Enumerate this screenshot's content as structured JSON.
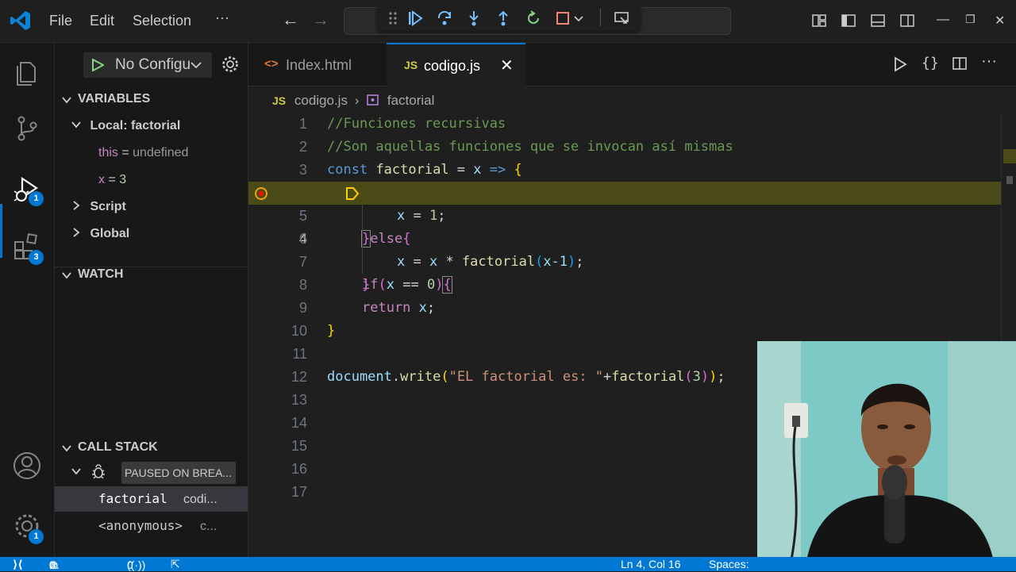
{
  "menu": {
    "file": "File",
    "edit": "Edit",
    "selection": "Selection",
    "more": "···"
  },
  "window": {
    "minimize": "—",
    "restore": "❐",
    "close": "✕"
  },
  "run": {
    "config_label": "No Configurations"
  },
  "variables": {
    "header": "VARIABLES",
    "scope_local": "Local: factorial",
    "vars": [
      {
        "name": "this",
        "eq": " = ",
        "value": "undefined"
      },
      {
        "name": "x",
        "eq": " = ",
        "value": "3"
      }
    ],
    "scope_script": "Script",
    "scope_global": "Global"
  },
  "watch": {
    "header": "WATCH"
  },
  "callstack": {
    "header": "CALL STACK",
    "paused": "PAUSED ON BREA...",
    "frames": [
      {
        "fn": "factorial",
        "src": "codi..."
      },
      {
        "fn": "<anonymous>",
        "src": "c..."
      }
    ]
  },
  "badges": {
    "debug": "1",
    "extensions": "3",
    "settings": "1"
  },
  "tabs": [
    {
      "label": "Index.html",
      "icon": "<>"
    },
    {
      "label": "codigo.js",
      "icon": "JS"
    }
  ],
  "breadcrumb": {
    "file_icon": "JS",
    "file": "codigo.js",
    "sep": "›",
    "symbol": "factorial"
  },
  "code_lines": [
    {
      "n": "1"
    },
    {
      "n": "2"
    },
    {
      "n": "3"
    },
    {
      "n": "4"
    },
    {
      "n": "5"
    },
    {
      "n": "6"
    },
    {
      "n": "7"
    },
    {
      "n": "8"
    },
    {
      "n": "9"
    },
    {
      "n": "10"
    },
    {
      "n": "11"
    },
    {
      "n": "12"
    },
    {
      "n": "13"
    },
    {
      "n": "14"
    },
    {
      "n": "15"
    },
    {
      "n": "16"
    },
    {
      "n": "17"
    }
  ],
  "code": {
    "l1": "//Funciones recursivas",
    "l2": "//Son aquellas funciones que se invocan así mismas",
    "l3_const": "const",
    "l3_name": "factorial",
    "l3_eq": " = ",
    "l3_x": "x",
    "l3_arrow": " => ",
    "l3_brace": "{",
    "l4_if": "if",
    "l4_open": "(",
    "l4_x": "x",
    "l4_op": " == ",
    "l4_num": "0",
    "l4_close": ")",
    "l4_brace": "{",
    "l5_x": "x",
    "l5_eq": " = ",
    "l5_num": "1",
    "l5_semi": ";",
    "l6_close": "}",
    "l6_else": "else",
    "l6_brace": "{",
    "l7_x": "x",
    "l7_eq": " = ",
    "l7_x2": "x",
    "l7_mul": " * ",
    "l7_fn": "factorial",
    "l7_open": "(",
    "l7_arg": "x-1",
    "l7_close": ")",
    "l7_semi": ";",
    "l8_close": "}",
    "l9_ret": "return",
    "l9_x": " x",
    "l9_semi": ";",
    "l10_close": "}",
    "l12_doc": "document",
    "l12_dot": ".",
    "l12_write": "write",
    "l12_open": "(",
    "l12_str": "\"EL factorial es: \"",
    "l12_plus": "+",
    "l12_fn": "factorial",
    "l12_open2": "(",
    "l12_num": "3",
    "l12_close2": ")",
    "l12_close": ")",
    "l12_semi": ";"
  },
  "status": {
    "remote": "⟩⟨",
    "errors": "0",
    "warnings": "0",
    "ports": "0",
    "position": "Ln 4, Col 16",
    "spaces": "Spaces:"
  },
  "colors": {
    "accent": "#0078d4",
    "highlight": "#4b4b18",
    "breakpoint": "#e8a317"
  }
}
